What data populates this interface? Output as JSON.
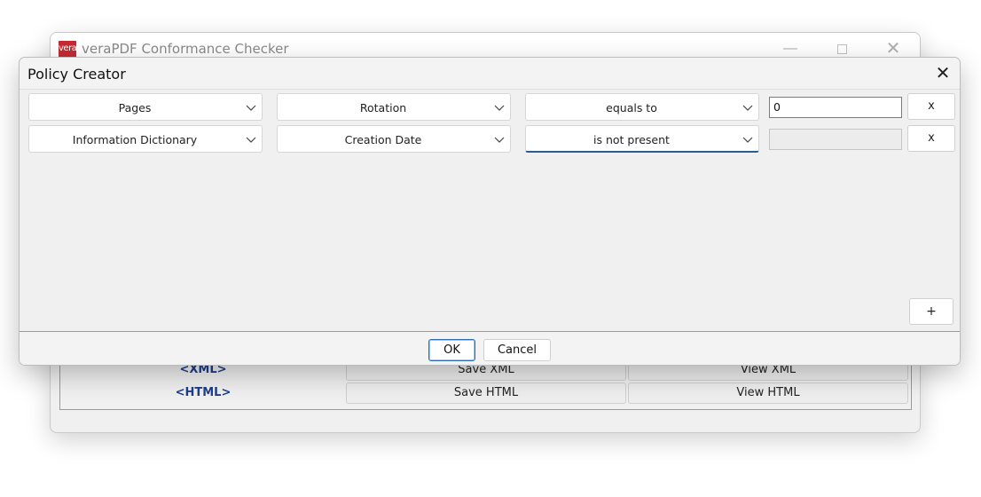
{
  "main_window": {
    "logo_text": "vera",
    "title": "veraPDF Conformance Checker",
    "controls": {
      "minimize": "—",
      "close": "✕"
    },
    "reports": [
      {
        "label": "<XML>",
        "save_label": "Save XML",
        "view_label": "View XML"
      },
      {
        "label": "<HTML>",
        "save_label": "Save HTML",
        "view_label": "View HTML"
      }
    ]
  },
  "dialog": {
    "title": "Policy Creator",
    "close_glyph": "✕",
    "rules": [
      {
        "object": "Pages",
        "property": "Rotation",
        "operator": "equals to",
        "value": "0",
        "remove_label": "x"
      },
      {
        "object": "Information Dictionary",
        "property": "Creation Date",
        "operator": "is not present",
        "value": "",
        "remove_label": "x"
      }
    ],
    "add_label": "+",
    "ok_label": "OK",
    "cancel_label": "Cancel"
  },
  "colors": {
    "accent": "#2e6db4",
    "report_label": "#1f3e8a",
    "logo_red": "#c62a32"
  }
}
